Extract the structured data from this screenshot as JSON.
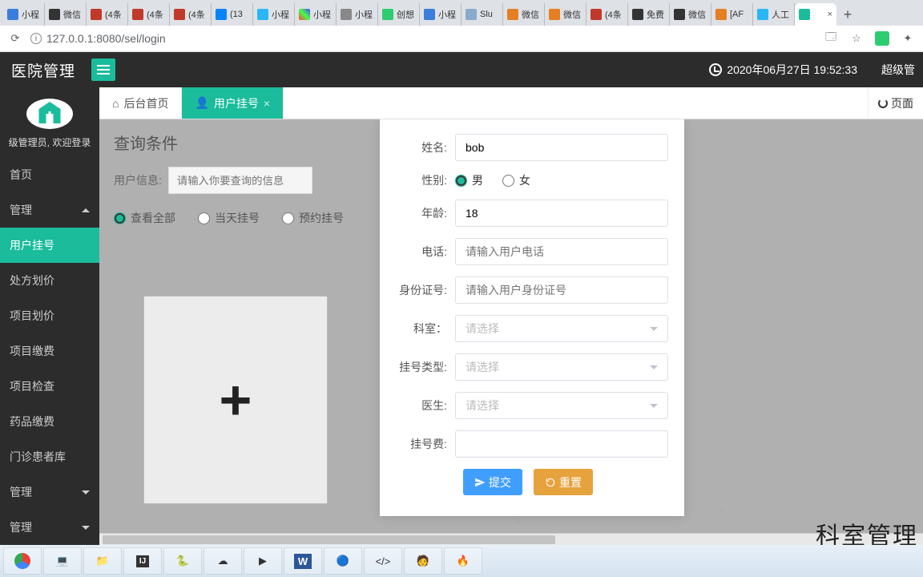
{
  "browser": {
    "tabs": [
      "小程",
      "微信",
      "(4条",
      "(4条",
      "(4条",
      "(13",
      "小程",
      "小程",
      "小程",
      "创想",
      "小程",
      "Slu",
      "微信",
      "微信",
      "(4条",
      "免费",
      "微信",
      "[AF",
      "人工",
      ""
    ],
    "active_index": 19,
    "url": "127.0.0.1:8080/sel/login"
  },
  "header": {
    "brand": "医院管理",
    "datetime": "2020年06月27日 19:52:33",
    "role": "超级管"
  },
  "sidebar": {
    "welcome": "级管理员, 欢迎登录",
    "items": [
      {
        "label": "首页",
        "type": "item"
      },
      {
        "label": "管理",
        "type": "group",
        "caret": "up"
      },
      {
        "label": "用户挂号",
        "type": "item",
        "active": true
      },
      {
        "label": "处方划价",
        "type": "item"
      },
      {
        "label": "项目划价",
        "type": "item"
      },
      {
        "label": "项目缴费",
        "type": "item"
      },
      {
        "label": "项目检查",
        "type": "item"
      },
      {
        "label": "药品缴费",
        "type": "item"
      },
      {
        "label": "门诊患者库",
        "type": "item"
      },
      {
        "label": "管理",
        "type": "group",
        "caret": "down"
      },
      {
        "label": "管理",
        "type": "group",
        "caret": "down"
      }
    ]
  },
  "tabs": {
    "home": "后台首页",
    "active": "用户挂号",
    "pageop": "页面"
  },
  "query": {
    "title": "查询条件",
    "label": "用户信息:",
    "placeholder": "请输入你要查询的信息",
    "radios": [
      "查看全部",
      "当天挂号",
      "预约挂号"
    ],
    "selected": 0
  },
  "form": {
    "name_label": "姓名:",
    "name_value": "bob",
    "gender_label": "性别:",
    "gender_options": [
      "男",
      "女"
    ],
    "gender_selected": 0,
    "age_label": "年龄:",
    "age_value": "18",
    "phone_label": "电话:",
    "phone_ph": "请输入用户电话",
    "id_label": "身份证号:",
    "id_ph": "请输入用户身份证号",
    "dept_label": "科室：",
    "dept_ph": "请选择",
    "type_label": "挂号类型:",
    "type_ph": "请选择",
    "doctor_label": "医生:",
    "doctor_ph": "请选择",
    "fee_label": "挂号费:",
    "submit": "提交",
    "reset": "重置"
  },
  "watermark": "科室管理"
}
